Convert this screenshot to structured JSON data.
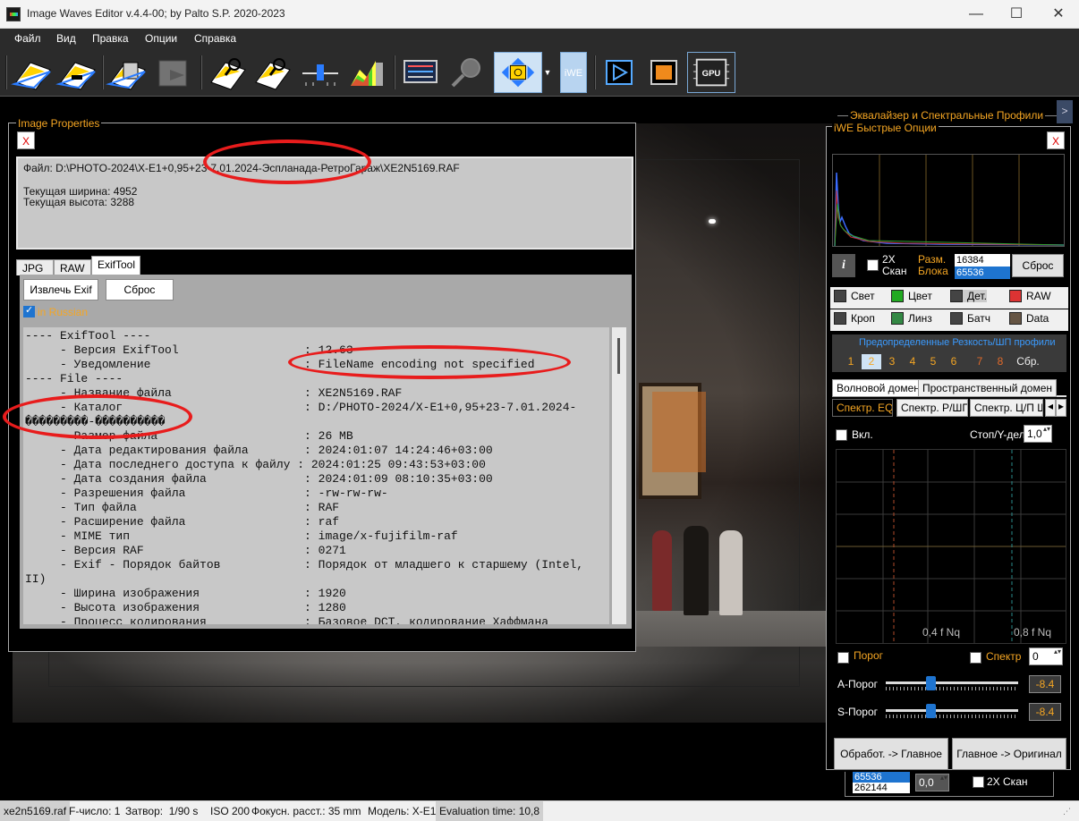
{
  "window": {
    "title": "Image Waves Editor  v.4.4-00; by Palto S.P.  2020-2023",
    "minimize": "—",
    "maximize": "☐",
    "close": "✕"
  },
  "menu": [
    "Файл",
    "Вид",
    "Правка",
    "Опции",
    "Справка"
  ],
  "toolbar": {
    "iwe_label": "iWE",
    "gpu_label": "GPU"
  },
  "image_properties": {
    "title": "Image Properties",
    "close": "X",
    "file_line": "Файл: D:\\PHOTO-2024\\X-E1+0,95+23-7.01.2024-Эспланада-РетроГараж\\XE2N5169.RAF",
    "width_line": "Текущая ширина: 4952",
    "height_line": "Текущая высота: 3288",
    "tabs": [
      "JPG",
      "RAW",
      "ExifTool"
    ],
    "extract_button": "Извлечь  Exif",
    "reset_button": "Сброс",
    "in_russian": "in Russian",
    "exif_lines": [
      "---- ExifTool ----",
      "     - Версия ExifTool                  : 12.63",
      "     - Уведомление                      : FileName encoding not specified",
      "---- File ----",
      "     - Название файла                   : XE2N5169.RAF",
      "     - Каталог                          : D:/PHOTO-2024/X-E1+0,95+23-7.01.2024-",
      "���������-����������",
      "     - Размер файла                     : 26 MB",
      "     - Дата редактирования файла        : 2024:01:07 14:24:46+03:00",
      "     - Дата последнего доступа к файлу : 2024:01:25 09:43:53+03:00",
      "     - Дата создания файла              : 2024:01:09 08:10:35+03:00",
      "     - Разрешения файла                 : -rw-rw-rw-",
      "     - Тип файла                        : RAF",
      "     - Расширение файла                 : raf",
      "     - MIME тип                         : image/x-fujifilm-raf",
      "     - Версия RAF                       : 0271",
      "     - Exif - Порядок байтов            : Порядок от младшего к старшему (Intel,",
      "II)",
      "     - Ширина изображения               : 1920",
      "     - Высота изображения               : 1280",
      "     - Процесс кодирования              : Базовое DCT, кодирование Хаффмана"
    ]
  },
  "right_panel": {
    "eq_title": "Эквалайзер и Спектральные Профили",
    "eq_arrow": ">",
    "quick_title": "iWE Быстрые Опции",
    "close": "X",
    "info_button": "i",
    "scan_2x": "2X\nСкан",
    "block_size": "Разм.\nБлока",
    "block_values": [
      "16384",
      "65536"
    ],
    "reset": "Сброс",
    "options_row1": [
      "Свет",
      "Цвет",
      "Дет.",
      "RAW"
    ],
    "options_row2": [
      "Кроп",
      "Линз",
      "Батч",
      "Data"
    ],
    "presets_title": "Предопределенные Резкость/ШП профили",
    "presets": [
      "1",
      "2",
      "3",
      "4",
      "5",
      "6",
      "7",
      "8",
      "Сбр."
    ],
    "domain_tabs": [
      "Волновой домен",
      "Пространственный домен"
    ],
    "spectrum_tabs": [
      "Спектр. EQ",
      "Спектр. Р/ШП",
      "Спектр. Ц/П Ш"
    ],
    "enable": "Вкл.",
    "stop_label": "Стоп/Y-дел.",
    "stop_value": "1,0",
    "tick_04": "0,4 f Nq",
    "tick_08": "0,8 f Nq",
    "threshold": "Порог",
    "spectr": "Спектр",
    "spectr_value": "0",
    "a_threshold": "А-Порог",
    "s_threshold": "S-Порог",
    "a_value": "-8.4",
    "s_value": "-8.4",
    "a_level": 0.33,
    "s_level": 0.33,
    "process_main": "Обработ. -> Главное",
    "main_original": "Главное -> Оригинал",
    "lower_values": [
      "65536",
      "262144"
    ],
    "lower_spin": "0,0",
    "lower_scan": "2X Скан"
  },
  "status": {
    "file": "xe2n5169.raf",
    "fnum": "F-число: 1",
    "shutter": "Затвор:  1/90 s",
    "iso": "ISO 200",
    "focal": "Фокусн. расст.: 35 mm",
    "model": "Модель: X-E1",
    "eval": "Evaluation time: 10,8"
  },
  "colors": {
    "accent_orange": "#f5a623",
    "selection_blue": "#1e74d0",
    "annotation_red": "#e81c1c"
  }
}
